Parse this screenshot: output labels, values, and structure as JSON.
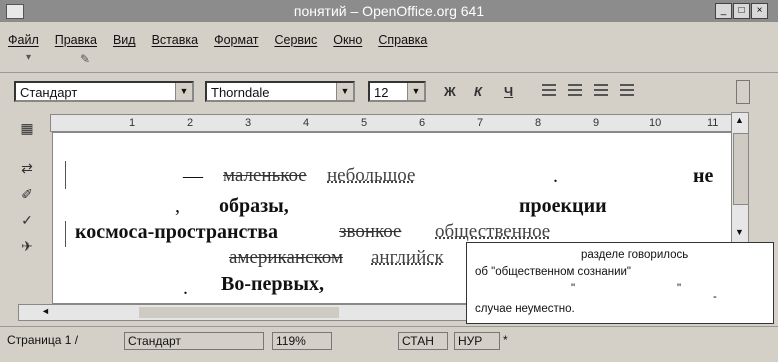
{
  "window": {
    "title": "понятий – OpenOffice.org 641",
    "buttons": [
      "_",
      "□",
      "×"
    ]
  },
  "menubar": {
    "items": [
      "Файл",
      "Правка",
      "Вид",
      "Вставка",
      "Формат",
      "Сервис",
      "Окно",
      "Справка"
    ]
  },
  "format_toolbar": {
    "style": "Стандарт",
    "font": "Thorndale",
    "size": "12",
    "bold_label": "Ж",
    "italic_label": "К",
    "underline_label": "Ч"
  },
  "ruler": {
    "ticks": [
      "1",
      "2",
      "3",
      "4",
      "5",
      "6",
      "7",
      "8",
      "9",
      "10",
      "11"
    ]
  },
  "document": {
    "line1": {
      "dash": "—",
      "struck": "маленькое",
      "inserted": "небольшое",
      "dot": ".",
      "right": "не"
    },
    "line2": {
      "comma": ",",
      "word1": "образы,",
      "word2": "проекции"
    },
    "line3": {
      "word1": "космоса-пространства",
      "struck": "звонкое",
      "inserted": "общественное"
    },
    "line4": {
      "struck": "американском",
      "inserted": "английск"
    },
    "line5": {
      "dot": ".",
      "word1": "Во-первых,"
    }
  },
  "note": {
    "line1": "разделе говорилось",
    "line2": "об \"общественном сознании\"",
    "q1": "\"",
    "q2": "\"",
    "q3": "-",
    "line4": "случае неуместно.",
    "line4_dot": "."
  },
  "statusbar": {
    "page": "Страница  1 /",
    "style": "Стандарт",
    "zoom": "119%",
    "mode1": "СТАН",
    "mode2": "НУР",
    "mode3": "*"
  }
}
